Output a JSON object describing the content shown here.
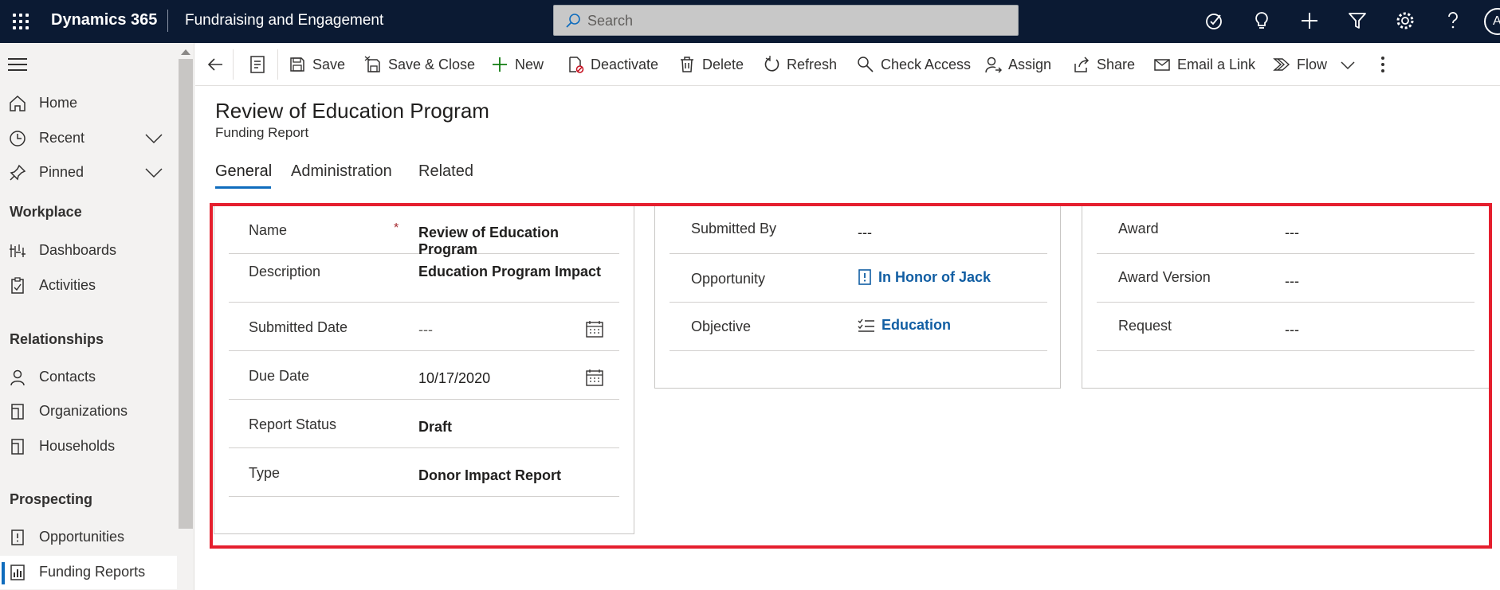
{
  "topbar": {
    "app_name": "Dynamics 365",
    "module_name": "Fundraising and Engagement",
    "search_placeholder": "Search",
    "avatar_initial": "A"
  },
  "sidebar": {
    "items": [
      {
        "label": "Home"
      },
      {
        "label": "Recent"
      },
      {
        "label": "Pinned"
      }
    ],
    "groups": [
      {
        "title": "Workplace",
        "items": [
          {
            "label": "Dashboards"
          },
          {
            "label": "Activities"
          }
        ]
      },
      {
        "title": "Relationships",
        "items": [
          {
            "label": "Contacts"
          },
          {
            "label": "Organizations"
          },
          {
            "label": "Households"
          }
        ]
      },
      {
        "title": "Prospecting",
        "items": [
          {
            "label": "Opportunities"
          },
          {
            "label": "Funding Reports"
          }
        ]
      }
    ]
  },
  "commands": {
    "save": "Save",
    "save_close": "Save & Close",
    "new": "New",
    "deactivate": "Deactivate",
    "delete": "Delete",
    "refresh": "Refresh",
    "check_access": "Check Access",
    "assign": "Assign",
    "share": "Share",
    "email_link": "Email a Link",
    "flow": "Flow"
  },
  "record": {
    "title": "Review of Education Program",
    "entity": "Funding Report"
  },
  "tabs": [
    "General",
    "Administration",
    "Related"
  ],
  "form": {
    "left": {
      "name_label": "Name",
      "name_required": "*",
      "name_value": "Review of Education Program",
      "description_label": "Description",
      "description_value": "Education Program Impact",
      "submitted_date_label": "Submitted Date",
      "submitted_date_value": "---",
      "due_date_label": "Due Date",
      "due_date_value": "10/17/2020",
      "report_status_label": "Report Status",
      "report_status_value": "Draft",
      "type_label": "Type",
      "type_value": "Donor Impact Report"
    },
    "middle": {
      "submitted_by_label": "Submitted By",
      "submitted_by_value": "---",
      "opportunity_label": "Opportunity",
      "opportunity_value": "In Honor of Jack",
      "objective_label": "Objective",
      "objective_value": "Education"
    },
    "right": {
      "award_label": "Award",
      "award_value": "---",
      "award_version_label": "Award Version",
      "award_version_value": "---",
      "request_label": "Request",
      "request_value": "---"
    }
  },
  "colors": {
    "topbar_bg": "#0b1a33",
    "accent": "#0f6cbd",
    "link": "#115ea3",
    "highlight_border": "#e51f2e",
    "required": "#a4262c"
  }
}
